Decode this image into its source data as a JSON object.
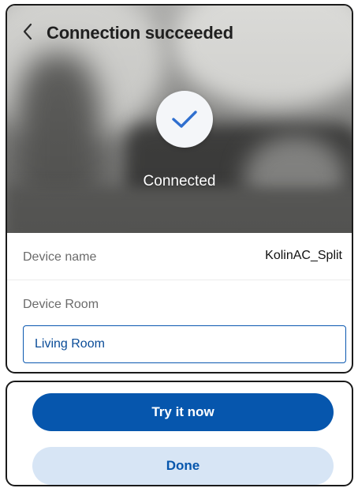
{
  "header": {
    "title": "Connection succeeded",
    "back_icon": "chevron-left-icon"
  },
  "status": {
    "icon": "checkmark-icon",
    "text": "Connected",
    "accent": "#2f6fcf"
  },
  "device": {
    "name_label": "Device name",
    "name_value": "KolinAC_Split",
    "room_label": "Device Room",
    "room_value": "Living Room"
  },
  "actions": {
    "primary_label": "Try it now",
    "secondary_label": "Done",
    "primary_color": "#0656ad",
    "secondary_color": "#d7e5f5"
  }
}
